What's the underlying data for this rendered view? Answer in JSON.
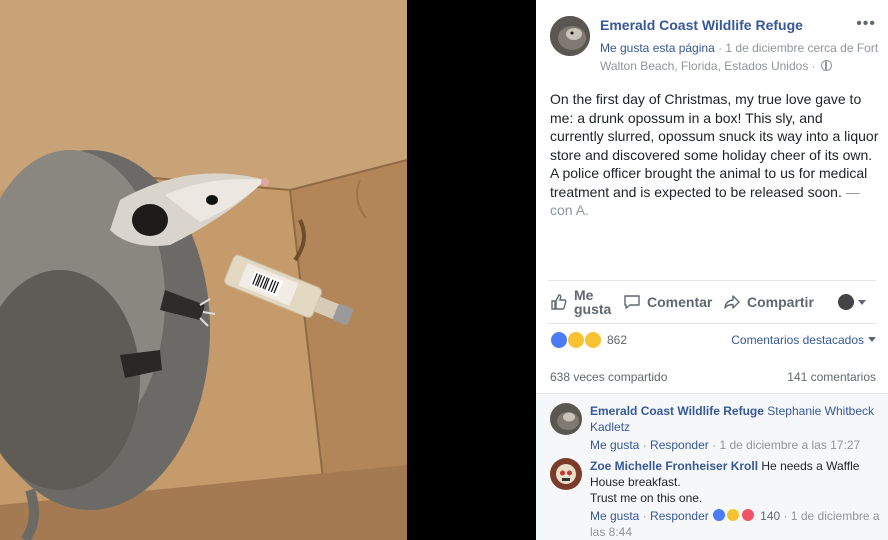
{
  "post": {
    "page_name": "Emerald Coast Wildlife Refuge",
    "like_page": "Me gusta esta página",
    "separator": " · ",
    "date_location": "1 de diciembre cerca de Fort Walton Beach, Florida, Estados Unidos",
    "privacy_separator": " · ",
    "more_label": "•••",
    "text": "On the first day of Christmas, my true love gave to me: a drunk opossum in a box! This sly, and currently slurred, opossum snuck its way into a liquor store and discovered some holiday cheer of its own. A police officer brought the animal to us for medical treatment and is expected to be released soon.",
    "with_text": " — con A."
  },
  "actions": {
    "like": "Me gusta",
    "comment": "Comentar",
    "share": "Compartir"
  },
  "reactions": {
    "count": "862",
    "sort_label": "Comentarios destacados"
  },
  "stats": {
    "shares": "638 veces compartido",
    "comments": "141 comentarios"
  },
  "comments": [
    {
      "author": "Emerald Coast Wildlife Refuge",
      "tag": "Stephanie Whitbeck Kadletz",
      "like": "Me gusta",
      "reply": "Responder",
      "time": "1 de diciembre a las 17:27"
    },
    {
      "author": "Zoe Michelle Fronheiser Kroll",
      "text1": "He needs a Waffle House breakfast.",
      "text2": "Trust me on this one.",
      "like": "Me gusta",
      "reply": "Responder",
      "reaction_count": "140",
      "time": "1 de diciembre a las 8:44"
    }
  ],
  "colors": {
    "link": "#365899",
    "muted": "#90949c",
    "text": "#1d2129",
    "bg": "#000000"
  },
  "icons": [
    "more-options-icon",
    "globe-icon",
    "like-thumb-icon",
    "comment-bubble-icon",
    "share-arrow-icon",
    "caret-down-icon",
    "like-reaction-icon",
    "haha-reaction-icon",
    "wow-reaction-icon"
  ]
}
